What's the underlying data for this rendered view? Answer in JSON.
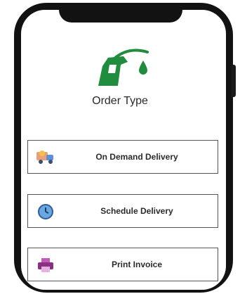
{
  "page": {
    "title": "Order Type"
  },
  "options": [
    {
      "label": "On Demand Delivery",
      "icon": "delivery-truck-icon"
    },
    {
      "label": "Schedule Delivery",
      "icon": "clock-icon"
    },
    {
      "label": "Print Invoice",
      "icon": "printer-icon"
    }
  ],
  "colors": {
    "brand_green": "#1f8c3e",
    "frame": "#121212"
  },
  "logo": {
    "icon": "fuel-nozzle-icon"
  }
}
